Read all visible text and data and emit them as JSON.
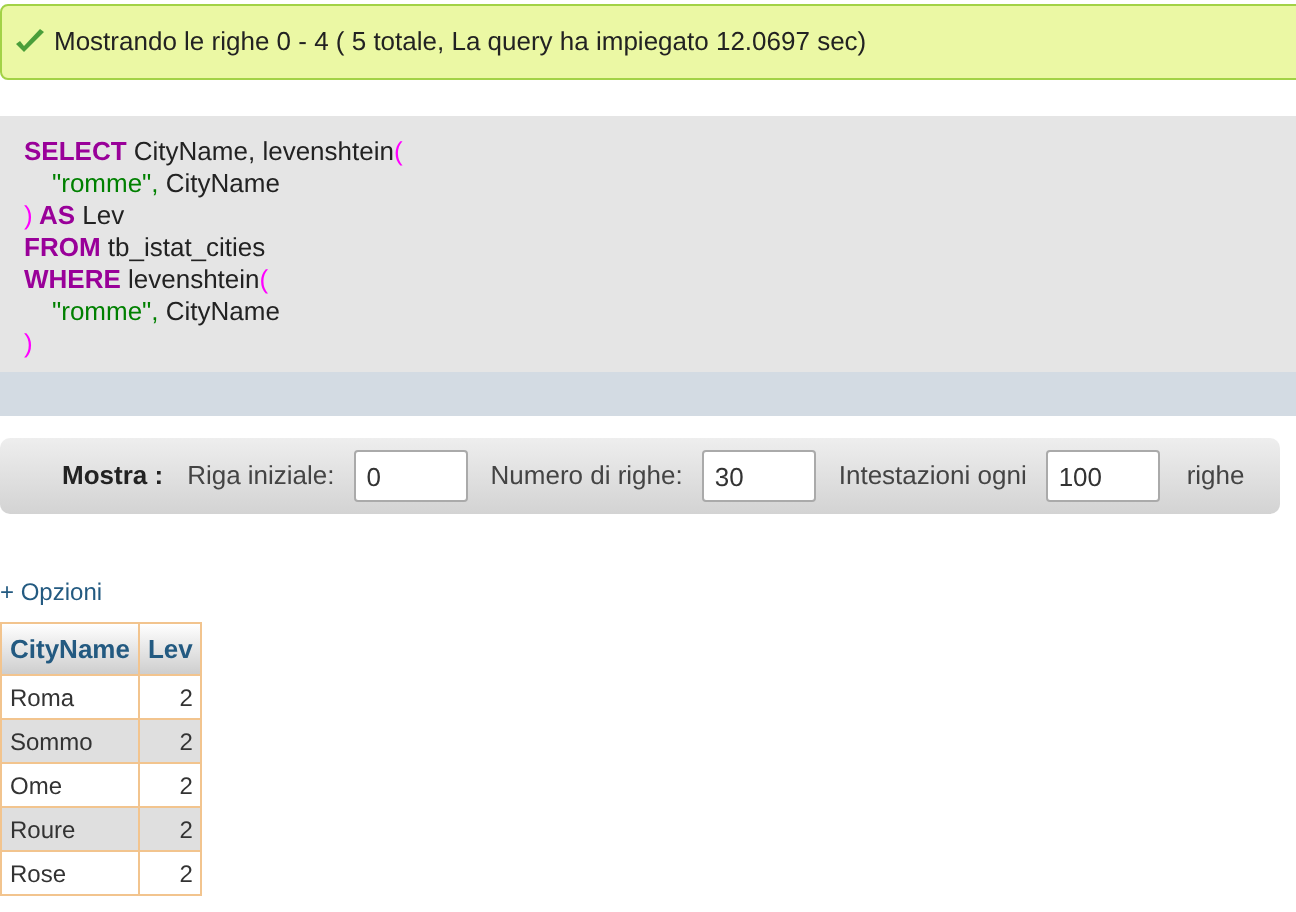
{
  "notice": {
    "text": "Mostrando le righe 0 - 4 ( 5 totale, La query ha impiegato 12.0697 sec)"
  },
  "sql_lines": [
    {
      "indented": false,
      "tokens": [
        {
          "kind": "keyword",
          "text": "SELECT"
        },
        {
          "kind": "name",
          "text": " CityName, levenshtein"
        },
        {
          "kind": "punct",
          "text": "("
        }
      ]
    },
    {
      "indented": true,
      "tokens": [
        {
          "kind": "string",
          "text": "\"romme\","
        },
        {
          "kind": "name",
          "text": " CityName"
        }
      ]
    },
    {
      "indented": false,
      "tokens": [
        {
          "kind": "punct",
          "text": ")"
        },
        {
          "kind": "keyword",
          "text": " AS"
        },
        {
          "kind": "name",
          "text": " Lev"
        }
      ]
    },
    {
      "indented": false,
      "tokens": [
        {
          "kind": "keyword",
          "text": "FROM"
        },
        {
          "kind": "name",
          "text": " tb_istat_cities"
        }
      ]
    },
    {
      "indented": false,
      "tokens": [
        {
          "kind": "keyword",
          "text": "WHERE"
        },
        {
          "kind": "name",
          "text": " levenshtein"
        },
        {
          "kind": "punct",
          "text": "("
        }
      ]
    },
    {
      "indented": true,
      "tokens": [
        {
          "kind": "string",
          "text": "\"romme\","
        },
        {
          "kind": "name",
          "text": " CityName"
        }
      ]
    },
    {
      "indented": false,
      "tokens": [
        {
          "kind": "punct",
          "text": ")"
        }
      ]
    }
  ],
  "toolbar": {
    "title": "Mostra :",
    "fields": [
      {
        "label": "Riga iniziale:",
        "value": "0"
      },
      {
        "label": "Numero di righe:",
        "value": "30"
      },
      {
        "label": "Intestazioni ogni",
        "value": "100"
      }
    ],
    "suffix": "righe"
  },
  "options_link": "+ Opzioni",
  "table": {
    "columns": [
      "CityName",
      "Lev"
    ],
    "rows": [
      [
        "Roma",
        "2"
      ],
      [
        "Sommo",
        "2"
      ],
      [
        "Ome",
        "2"
      ],
      [
        "Roure",
        "2"
      ],
      [
        "Rose",
        "2"
      ]
    ]
  }
}
